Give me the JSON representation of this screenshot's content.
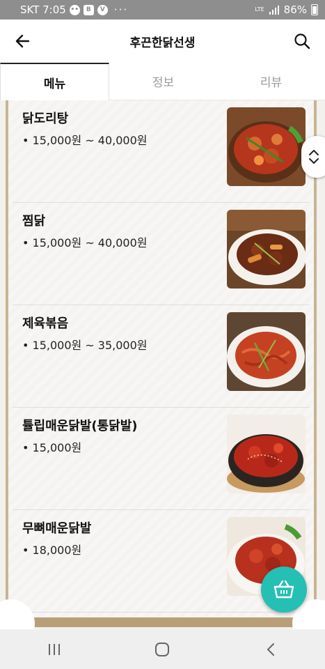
{
  "status_bar": {
    "carrier_time": "SKT 7:05",
    "notification_icons": [
      "chat-bubble-icon",
      "b-app-icon",
      "v-app-icon"
    ],
    "more": "···",
    "network_label": "LTE",
    "battery": "86%"
  },
  "header": {
    "title": "후끈한닭선생",
    "back_icon": "back-arrow-icon",
    "search_icon": "search-icon"
  },
  "tabs": [
    {
      "label": "메뉴",
      "active": true
    },
    {
      "label": "정보",
      "active": false
    },
    {
      "label": "리뷰",
      "active": false
    }
  ],
  "menu_items": [
    {
      "name": "닭도리탕",
      "price": "• 15,000원 ~ 40,000원",
      "photo": "braised-chicken-photo"
    },
    {
      "name": "찜닭",
      "price": "• 15,000원 ~ 40,000원",
      "photo": "jjimdak-photo"
    },
    {
      "name": "제육볶음",
      "price": "• 15,000원 ~ 35,000원",
      "photo": "stir-fried-pork-photo"
    },
    {
      "name": "튤립매운닭발(통닭발)",
      "price": "• 15,000원",
      "photo": "spicy-chicken-feet-photo"
    },
    {
      "name": "무뼈매운닭발",
      "price": "• 18,000원",
      "photo": "boneless-chicken-feet-photo"
    }
  ],
  "cart_icon": "basket-icon",
  "colors": {
    "accent": "#25bfb3",
    "board_frame": "#c8b493",
    "status_bar": "#8e8e8e"
  },
  "nav_bar": [
    "recent-apps-icon",
    "home-icon",
    "back-icon"
  ]
}
